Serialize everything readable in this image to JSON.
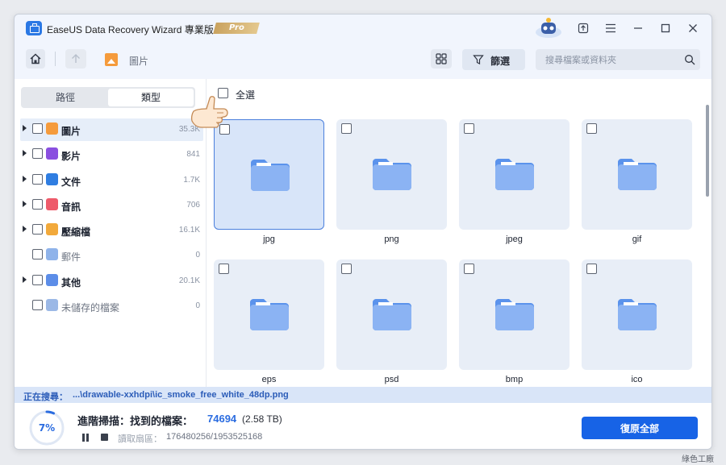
{
  "app": {
    "title": "EaseUS Data Recovery Wizard 專業版",
    "badge": "Pro"
  },
  "toolbar": {
    "breadcrumb": "圖片",
    "filter_label": "篩選",
    "search_placeholder": "搜尋檔案或資料夾"
  },
  "sidebar": {
    "tabs": [
      {
        "label": "路徑",
        "active": false
      },
      {
        "label": "類型",
        "active": true
      }
    ],
    "categories": [
      {
        "label": "圖片",
        "count": "35.3K",
        "icon": "image-icon",
        "color": "#f59b3c",
        "expandable": true,
        "selected": true
      },
      {
        "label": "影片",
        "count": "841",
        "icon": "video-icon",
        "color": "#8a4fe0",
        "expandable": true,
        "selected": false
      },
      {
        "label": "文件",
        "count": "1.7K",
        "icon": "document-icon",
        "color": "#2f7de1",
        "expandable": true,
        "selected": false
      },
      {
        "label": "音訊",
        "count": "706",
        "icon": "audio-icon",
        "color": "#ee5a6a",
        "expandable": true,
        "selected": false
      },
      {
        "label": "壓縮檔",
        "count": "16.1K",
        "icon": "archive-icon",
        "color": "#f2a93b",
        "expandable": true,
        "selected": false
      },
      {
        "label": "郵件",
        "count": "0",
        "icon": "mail-icon",
        "color": "#8fb3ea",
        "expandable": false,
        "selected": false
      },
      {
        "label": "其他",
        "count": "20.1K",
        "icon": "folder-other-icon",
        "color": "#5c8de8",
        "expandable": true,
        "selected": false
      },
      {
        "label": "未儲存的檔案",
        "count": "0",
        "icon": "unsaved-file-icon",
        "color": "#9bb8e6",
        "expandable": false,
        "selected": false
      }
    ]
  },
  "main": {
    "select_all": "全選",
    "tiles": [
      {
        "label": "jpg",
        "selected": true
      },
      {
        "label": "png",
        "selected": false
      },
      {
        "label": "jpeg",
        "selected": false
      },
      {
        "label": "gif",
        "selected": false
      },
      {
        "label": "eps",
        "selected": false
      },
      {
        "label": "psd",
        "selected": false
      },
      {
        "label": "bmp",
        "selected": false
      },
      {
        "label": "ico",
        "selected": false
      }
    ]
  },
  "status": {
    "searching_label": "正在搜尋：",
    "searching_path": "...\\drawable-xxhdpi\\ic_smoke_free_white_48dp.png",
    "progress_percent": 7,
    "progress_text": "7%",
    "scan_title": "進階掃描：找到的檔案：",
    "found_count": "74694",
    "found_size": "(2.58 TB)",
    "sector_label": "讀取扇區：",
    "sector_value": "176480256/1953525168",
    "recover_all": "復原全部"
  },
  "colors": {
    "accent": "#1763e6",
    "folder": "#5b93ec",
    "selected_tile_border": "#4a7fdd"
  },
  "watermark": "綠色工廠"
}
